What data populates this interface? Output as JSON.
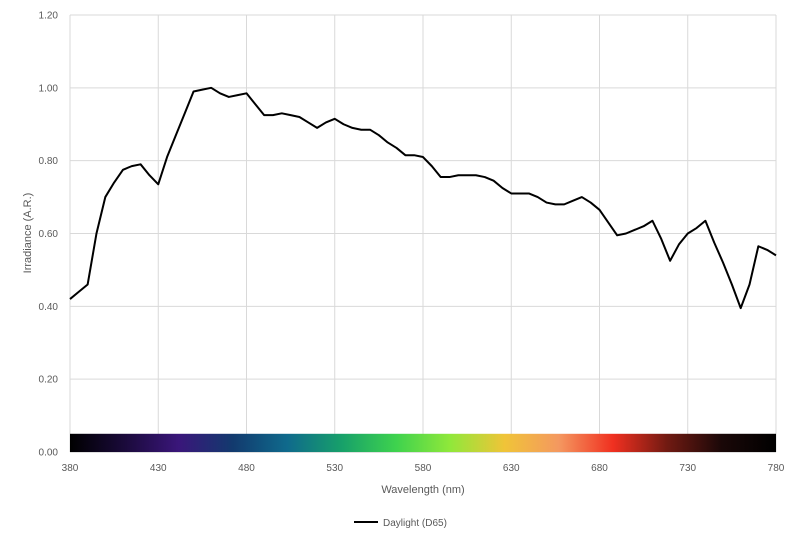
{
  "chart_data": {
    "type": "line",
    "xlabel": "Wavelength (nm)",
    "ylabel": "Irradiance (A.R.)",
    "xlim": [
      380,
      780
    ],
    "ylim": [
      0,
      1.2
    ],
    "x_ticks": [
      "380",
      "430",
      "480",
      "530",
      "580",
      "630",
      "680",
      "730",
      "780"
    ],
    "y_ticks": [
      "0.00",
      "0.20",
      "0.40",
      "0.60",
      "0.80",
      "1.00",
      "1.20"
    ],
    "grid": true,
    "legend_position": "bottom",
    "spectrum_band": {
      "y_range": [
        0,
        0.05
      ],
      "colors": [
        "#000000",
        "#1a0a3a",
        "#3a167a",
        "#123a6e",
        "#0f6a8c",
        "#17a06a",
        "#3ed24e",
        "#90e83a",
        "#f0c438",
        "#f49860",
        "#f03020",
        "#701a12",
        "#1a0808",
        "#000000"
      ]
    },
    "series": [
      {
        "name": "Daylight (D65)",
        "color": "#000000",
        "x": [
          380,
          385,
          390,
          395,
          400,
          405,
          410,
          415,
          420,
          425,
          430,
          435,
          440,
          445,
          450,
          455,
          460,
          465,
          470,
          475,
          480,
          485,
          490,
          495,
          500,
          505,
          510,
          515,
          520,
          525,
          530,
          535,
          540,
          545,
          550,
          555,
          560,
          565,
          570,
          575,
          580,
          585,
          590,
          595,
          600,
          605,
          610,
          615,
          620,
          625,
          630,
          635,
          640,
          645,
          650,
          655,
          660,
          665,
          670,
          675,
          680,
          685,
          690,
          695,
          700,
          705,
          710,
          715,
          720,
          725,
          730,
          735,
          740,
          745,
          750,
          755,
          760,
          765,
          770,
          775,
          780
        ],
        "values": [
          0.42,
          0.44,
          0.46,
          0.6,
          0.7,
          0.74,
          0.775,
          0.785,
          0.79,
          0.76,
          0.735,
          0.81,
          0.87,
          0.93,
          0.99,
          0.995,
          1.0,
          0.985,
          0.975,
          0.98,
          0.985,
          0.955,
          0.925,
          0.925,
          0.93,
          0.925,
          0.92,
          0.905,
          0.89,
          0.905,
          0.915,
          0.9,
          0.89,
          0.885,
          0.885,
          0.87,
          0.85,
          0.835,
          0.815,
          0.815,
          0.81,
          0.785,
          0.755,
          0.755,
          0.76,
          0.76,
          0.76,
          0.755,
          0.745,
          0.725,
          0.71,
          0.71,
          0.71,
          0.7,
          0.685,
          0.68,
          0.68,
          0.69,
          0.7,
          0.685,
          0.665,
          0.63,
          0.595,
          0.6,
          0.61,
          0.62,
          0.635,
          0.585,
          0.525,
          0.57,
          0.6,
          0.615,
          0.635,
          0.575,
          0.52,
          0.46,
          0.395,
          0.46,
          0.565,
          0.555,
          0.54
        ]
      }
    ]
  }
}
